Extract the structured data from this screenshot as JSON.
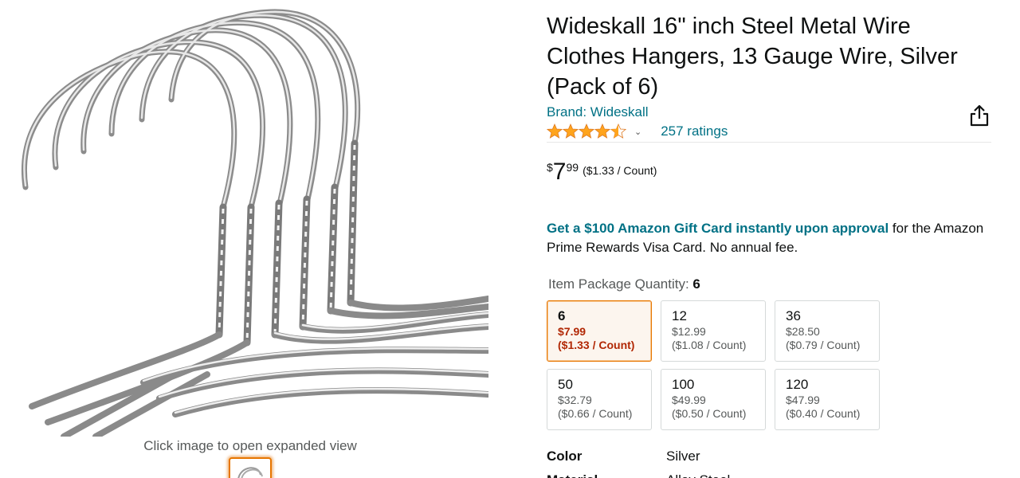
{
  "image": {
    "caption": "Click image to open expanded view",
    "main_alt_icon": "hanger-photo",
    "thumbnail_icon": "hanger-thumbnail"
  },
  "product": {
    "title": "Wideskall 16\" inch Steel Metal Wire Clothes Hangers, 13 Gauge Wire, Silver (Pack of 6)",
    "brand": "Brand: Wideskall",
    "rating_stars": 4.5,
    "ratings_count": "257 ratings",
    "price": {
      "symbol": "$",
      "whole": "7",
      "fraction": "99",
      "unit": "($1.33 / Count)"
    },
    "promo": {
      "link_text": "Get a $100 Amazon Gift Card instantly upon approval",
      "rest_text": " for the Amazon Prime Rewards Visa Card. No annual fee."
    },
    "quantity_label": "Item Package Quantity: ",
    "quantity_selected": "6",
    "quantity_options": [
      {
        "qty": "6",
        "price": "$7.99",
        "unit": "($1.33 / Count)",
        "selected": true
      },
      {
        "qty": "12",
        "price": "$12.99",
        "unit": "($1.08 / Count)",
        "selected": false
      },
      {
        "qty": "36",
        "price": "$28.50",
        "unit": "($0.79 / Count)",
        "selected": false
      },
      {
        "qty": "50",
        "price": "$32.79",
        "unit": "($0.66 / Count)",
        "selected": false
      },
      {
        "qty": "100",
        "price": "$49.99",
        "unit": "($0.50 / Count)",
        "selected": false
      },
      {
        "qty": "120",
        "price": "$47.99",
        "unit": "($0.40 / Count)",
        "selected": false
      }
    ],
    "specs": [
      {
        "key": "Color",
        "value": "Silver"
      },
      {
        "key": "Material",
        "value": "Alloy Steel"
      }
    ]
  },
  "colors": {
    "link": "#007185",
    "star": "#ffa41c",
    "selected_border": "#e77600",
    "price_red": "#b12704"
  },
  "icons": {
    "share": "share-icon",
    "star": "star-icon",
    "chevron": "chevron-down-icon"
  }
}
